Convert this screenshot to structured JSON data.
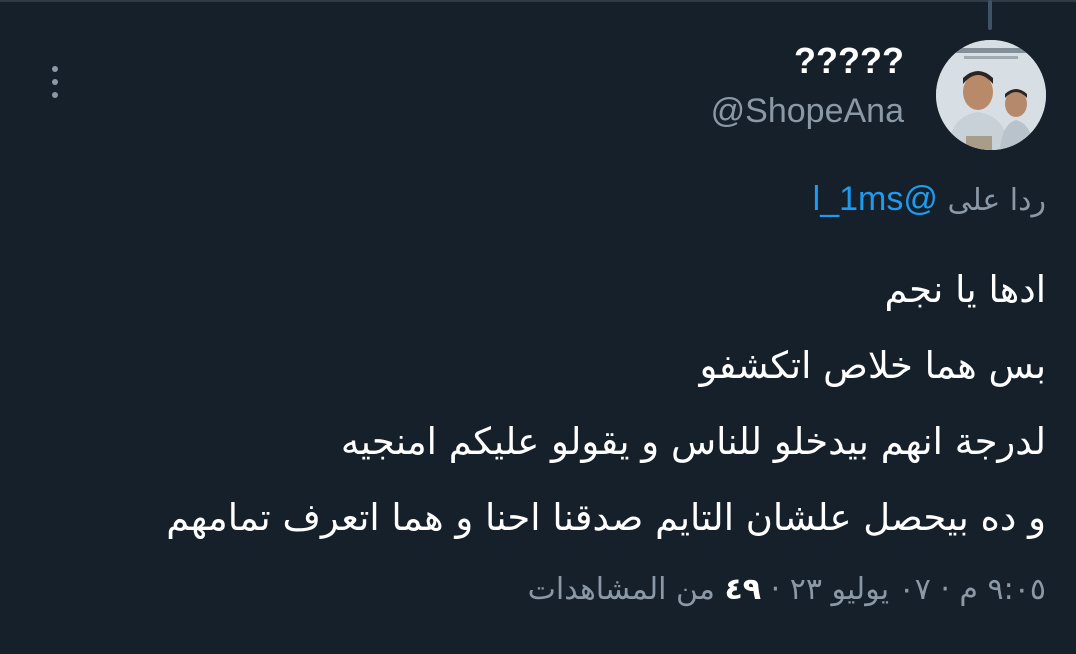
{
  "tweet": {
    "display_name": "?????",
    "handle": "@ShopeAna",
    "reply_prefix": "ردا على",
    "reply_mention": "@l_1ms",
    "text_lines": [
      "ادها يا نجم",
      "بس هما خلاص اتكشفو",
      "لدرجة انهم بيدخلو للناس و يقولو عليكم امنجيه",
      "و ده بيحصل علشان التايم صدقنا احنا و هما اتعرف تمامهم"
    ],
    "timestamp": "٩:٠٥ م · ٠٧ يوليو ٢٣ ·",
    "views_count": "٤٩",
    "views_label": "من المشاهدات"
  },
  "icons": {
    "more": "more-vertical-icon",
    "avatar": "profile-avatar"
  },
  "colors": {
    "background": "#15202b",
    "primary_text": "#ffffff",
    "secondary_text": "#8b98a5",
    "link": "#1d9bf0"
  }
}
